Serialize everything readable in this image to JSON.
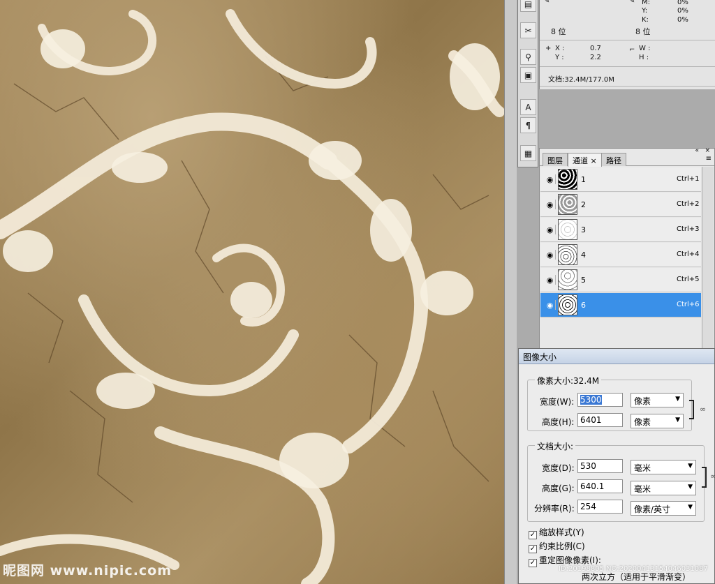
{
  "info_panel": {
    "m_label": "M:",
    "m_value": "0%",
    "y_label": "Y:",
    "y_value": "0%",
    "k_label": "K:",
    "k_value": "0%",
    "bit_left": "8 位",
    "bit_right": "8 位",
    "x_label": "X :",
    "x_value": "0.7",
    "yc_label": "Y :",
    "yc_value": "2.2",
    "w_label": "W :",
    "h_label": "H :",
    "doc_label": "文档:32.4M/177.0M"
  },
  "channels_panel": {
    "tabs": [
      {
        "label": "图层"
      },
      {
        "label": "通道"
      },
      {
        "label": "路径"
      }
    ],
    "channels": [
      {
        "name": "1",
        "shortcut": "Ctrl+1"
      },
      {
        "name": "2",
        "shortcut": "Ctrl+2"
      },
      {
        "name": "3",
        "shortcut": "Ctrl+3"
      },
      {
        "name": "4",
        "shortcut": "Ctrl+4"
      },
      {
        "name": "5",
        "shortcut": "Ctrl+5"
      },
      {
        "name": "6",
        "shortcut": "Ctrl+6"
      }
    ],
    "selected_index": 5
  },
  "dialog": {
    "title": "图像大小",
    "pixel_size_label": "像素大小:32.4M",
    "width_label": "宽度(W):",
    "width_value": "5300",
    "width_unit": "像素",
    "height_label": "高度(H):",
    "height_value": "6401",
    "height_unit": "像素",
    "doc_size_label": "文档大小:",
    "doc_width_label": "宽度(D):",
    "doc_width_value": "530",
    "doc_width_unit": "毫米",
    "doc_height_label": "高度(G):",
    "doc_height_value": "640.1",
    "doc_height_unit": "毫米",
    "resolution_label": "分辨率(R):",
    "resolution_value": "254",
    "resolution_unit": "像素/英寸",
    "scale_styles": "缩放样式(Y)",
    "constrain": "约束比例(C)",
    "resample": "重定图像像素(I):",
    "resample_method": "两次立方（适用于平滑渐变）"
  },
  "watermark": {
    "logo": "昵图网 www.nipic.com",
    "id": "ID:20198805 NO:20200413154046031087"
  },
  "colors": {
    "selection": "#3a90e8",
    "panel_bg": "#e8e8e8",
    "accent_field": "#3a78d4"
  }
}
